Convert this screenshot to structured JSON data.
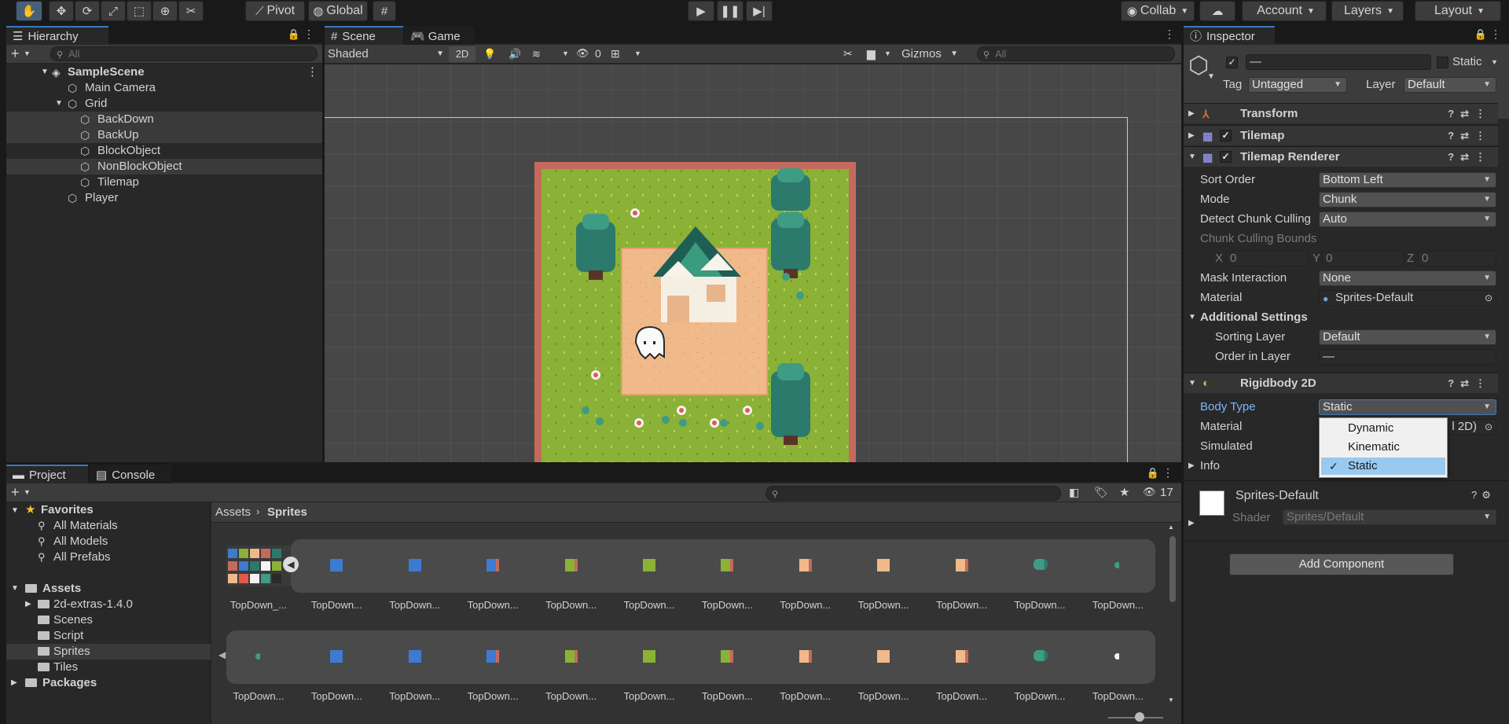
{
  "toolbar": {
    "tools": [
      "hand-tool",
      "move-tool",
      "rotate-tool",
      "scale-tool",
      "rect-tool",
      "transform-tool",
      "custom-tool"
    ],
    "pivot_label": "Pivot",
    "global_label": "Global",
    "collab_label": "Collab",
    "account_label": "Account",
    "layers_label": "Layers",
    "layout_label": "Layout"
  },
  "hierarchy": {
    "tab_label": "Hierarchy",
    "search_placeholder": "All",
    "scene_name": "SampleScene",
    "items": [
      {
        "label": "Main Camera",
        "indent": 1
      },
      {
        "label": "Grid",
        "indent": 1
      },
      {
        "label": "BackDown",
        "indent": 2
      },
      {
        "label": "BackUp",
        "indent": 2
      },
      {
        "label": "BlockObject",
        "indent": 2
      },
      {
        "label": "NonBlockObject",
        "indent": 2
      },
      {
        "label": "Tilemap",
        "indent": 2
      },
      {
        "label": "Player",
        "indent": 1
      }
    ]
  },
  "scene": {
    "tab_scene": "Scene",
    "tab_game": "Game",
    "shading_mode": "Shaded",
    "mode_2d": "2D",
    "hidden_count": "0",
    "gizmos_label": "Gizmos",
    "search_placeholder": "All"
  },
  "inspector": {
    "tab_label": "Inspector",
    "object_name": "—",
    "static_label": "Static",
    "tag_label": "Tag",
    "tag_value": "Untagged",
    "layer_label": "Layer",
    "layer_value": "Default",
    "components": {
      "transform": "Transform",
      "tilemap": "Tilemap",
      "tilemap_renderer": "Tilemap Renderer",
      "rigidbody": "Rigidbody 2D"
    },
    "renderer": {
      "sort_order_label": "Sort Order",
      "sort_order_value": "Bottom Left",
      "mode_label": "Mode",
      "mode_value": "Chunk",
      "detect_label": "Detect Chunk Culling",
      "detect_value": "Auto",
      "bounds_label": "Chunk Culling Bounds",
      "x_label": "X",
      "x_value": "0",
      "y_label": "Y",
      "y_value": "0",
      "z_label": "Z",
      "z_value": "0",
      "mask_label": "Mask Interaction",
      "mask_value": "None",
      "material_label": "Material",
      "material_value": "Sprites-Default",
      "additional_label": "Additional Settings",
      "sorting_layer_label": "Sorting Layer",
      "sorting_layer_value": "Default",
      "order_label": "Order in Layer",
      "order_value": "—"
    },
    "rigidbody": {
      "body_type_label": "Body Type",
      "body_type_value": "Static",
      "material_label": "Material",
      "material_partial": "l 2D)",
      "simulated_label": "Simulated",
      "info_label": "Info",
      "dropdown_options": [
        "Dynamic",
        "Kinematic",
        "Static"
      ],
      "selected_option": "Static"
    },
    "material_preview": {
      "name": "Sprites-Default",
      "shader_label": "Shader",
      "shader_value": "Sprites/Default"
    },
    "add_component_label": "Add Component"
  },
  "project": {
    "tab_project": "Project",
    "tab_console": "Console",
    "count": "17",
    "favorites_label": "Favorites",
    "favorites": [
      "All Materials",
      "All Models",
      "All Prefabs"
    ],
    "assets_label": "Assets",
    "asset_folders": [
      "2d-extras-1.4.0",
      "Scenes",
      "Script",
      "Sprites",
      "Tiles"
    ],
    "packages_label": "Packages",
    "breadcrumb_root": "Assets",
    "breadcrumb_current": "Sprites",
    "row1_labels": [
      "TopDown_...",
      "TopDown...",
      "TopDown...",
      "TopDown...",
      "TopDown...",
      "TopDown...",
      "TopDown...",
      "TopDown...",
      "TopDown...",
      "TopDown...",
      "TopDown...",
      "TopDown..."
    ],
    "row2_labels": [
      "TopDown...",
      "TopDown...",
      "TopDown...",
      "TopDown...",
      "TopDown...",
      "TopDown...",
      "TopDown...",
      "TopDown...",
      "TopDown...",
      "TopDown...",
      "TopDown...",
      "TopDown..."
    ],
    "row1_tiles": [
      "sheet",
      "blue",
      "blue",
      "blue-edge",
      "green-edge",
      "green",
      "green-edge",
      "sand-edge",
      "sand",
      "sand-edge",
      "teal",
      "sprout"
    ],
    "row2_tiles": [
      "sprout",
      "blue",
      "blue",
      "blue-edge",
      "green-edge",
      "green",
      "green-edge",
      "sand-edge",
      "sand",
      "sand-edge",
      "teal",
      "flower"
    ]
  },
  "colors": {
    "selection": "#3a79bb",
    "grass": "#8bb136",
    "sand": "#f0b98a",
    "tree": "#2c7a6b",
    "border": "#c46a5c"
  }
}
